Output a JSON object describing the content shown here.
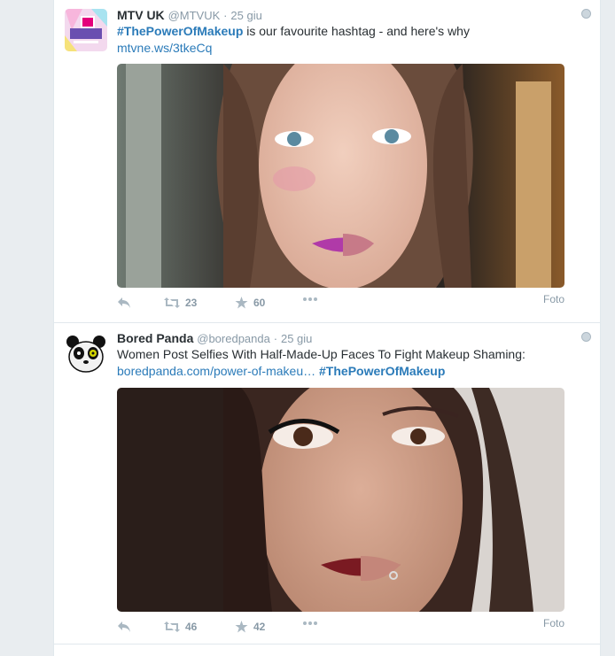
{
  "tweets": [
    {
      "name": "MTV UK",
      "handle": "@MTVUK",
      "separator": "·",
      "time": "25 giu",
      "text_hashtag": "#ThePowerOfMakeup",
      "text_body": " is our favourite hashtag - and here's why",
      "text_link": "mtvne.ws/3tkeCq",
      "retweets": "23",
      "favorites": "60",
      "media_label": "Foto"
    },
    {
      "name": "Bored Panda",
      "handle": "@boredpanda",
      "separator": "·",
      "time": "25 giu",
      "text_body": "Women Post Selfies With Half-Made-Up Faces To Fight Makeup Shaming:",
      "text_link": "boredpanda.com/power-of-makeu…",
      "text_hashtag": "#ThePowerOfMakeup",
      "retweets": "46",
      "favorites": "42",
      "media_label": "Foto"
    }
  ],
  "icons": {
    "reply": "reply-icon",
    "retweet": "retweet-icon",
    "favorite": "star-icon",
    "more": "more-icon",
    "globe": "globe-icon"
  },
  "colors": {
    "link": "#2b7bb9",
    "muted": "#8899a6",
    "background": "#e9edf0"
  }
}
